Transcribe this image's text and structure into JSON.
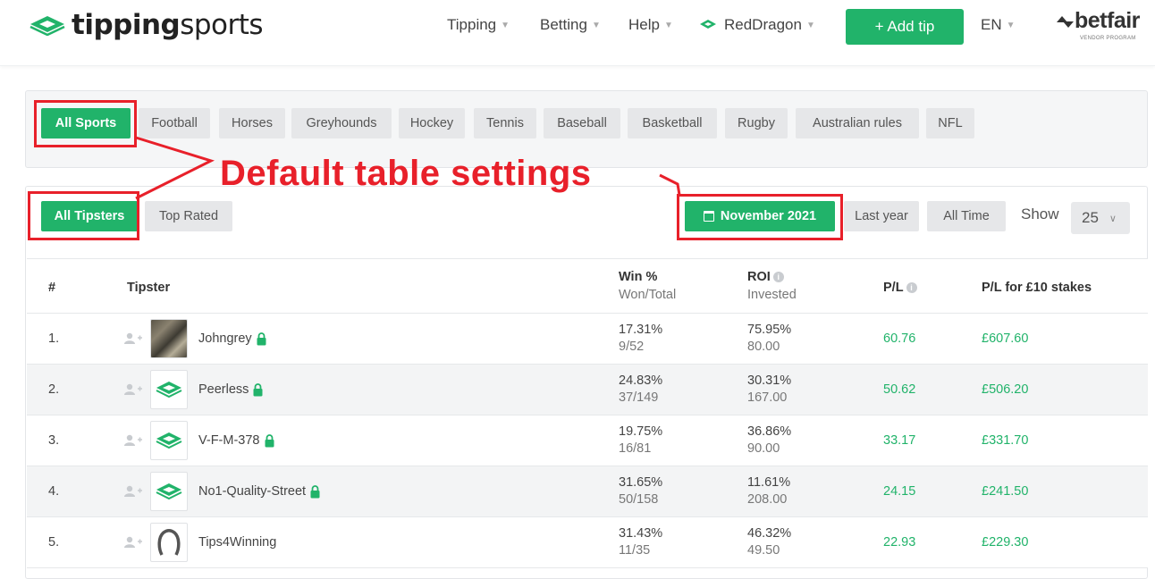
{
  "header": {
    "logo_text_bold": "tipping",
    "logo_text_light": "sports",
    "nav": [
      {
        "label": "Tipping"
      },
      {
        "label": "Betting"
      },
      {
        "label": "Help"
      },
      {
        "label": "RedDragon"
      }
    ],
    "add_tip_label": "+ Add tip",
    "lang": "EN",
    "betfair_name": "betfair",
    "betfair_sub": "VENDOR PROGRAM"
  },
  "sports": [
    "All Sports",
    "Football",
    "Horses",
    "Greyhounds",
    "Hockey",
    "Tennis",
    "Baseball",
    "Basketball",
    "Rugby",
    "Australian rules",
    "NFL"
  ],
  "annotation": "Default table settings",
  "filters": {
    "tipsters": [
      "All Tipsters",
      "Top Rated"
    ],
    "period_active": "November 2021",
    "period_others": [
      "Last year",
      "All Time"
    ],
    "show_label": "Show",
    "show_value": "25"
  },
  "table": {
    "headers": {
      "rank": "#",
      "tipster": "Tipster",
      "win": "Win %",
      "win_sub": "Won/Total",
      "roi": "ROI",
      "roi_sub": "Invested",
      "pl": "P/L",
      "pl10": "P/L for £10 stakes"
    },
    "rows": [
      {
        "rank": "1.",
        "name": "Johngrey",
        "win": "17.31%",
        "won_total": "9/52",
        "roi": "75.95%",
        "invested": "80.00",
        "pl": "60.76",
        "pl10": "£607.60",
        "avatar": "photo",
        "locked": true
      },
      {
        "rank": "2.",
        "name": "Peerless",
        "win": "24.83%",
        "won_total": "37/149",
        "roi": "30.31%",
        "invested": "167.00",
        "pl": "50.62",
        "pl10": "£506.20",
        "avatar": "logo",
        "locked": true
      },
      {
        "rank": "3.",
        "name": "V-F-M-378",
        "win": "19.75%",
        "won_total": "16/81",
        "roi": "36.86%",
        "invested": "90.00",
        "pl": "33.17",
        "pl10": "£331.70",
        "avatar": "logo",
        "locked": true
      },
      {
        "rank": "4.",
        "name": "No1-Quality-Street",
        "win": "31.65%",
        "won_total": "50/158",
        "roi": "11.61%",
        "invested": "208.00",
        "pl": "24.15",
        "pl10": "£241.50",
        "avatar": "logo",
        "locked": true
      },
      {
        "rank": "5.",
        "name": "Tips4Winning",
        "win": "31.43%",
        "won_total": "11/35",
        "roi": "46.32%",
        "invested": "49.50",
        "pl": "22.93",
        "pl10": "£229.30",
        "avatar": "horseshoe",
        "locked": false
      }
    ]
  },
  "colors": {
    "accent": "#21b36a",
    "annotation": "#e8202a"
  }
}
